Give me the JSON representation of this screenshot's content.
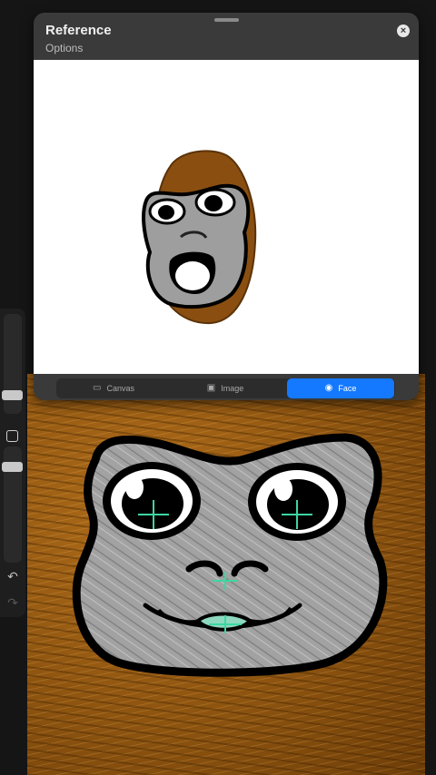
{
  "panel": {
    "title": "Reference",
    "subtitle": "Options",
    "close_icon": "×"
  },
  "tabs": [
    {
      "label": "Canvas",
      "icon": "canvas-icon",
      "active": false
    },
    {
      "label": "Image",
      "icon": "image-icon",
      "active": false
    },
    {
      "label": "Face",
      "icon": "face-icon",
      "active": true
    }
  ],
  "rail": {
    "undo_icon": "↶",
    "redo_icon": "↷"
  },
  "colors": {
    "accent": "#1479ff",
    "fur": "#8d5410",
    "face_skin": "#9a9a9a",
    "tracking_marker": "#3dd6a0"
  }
}
